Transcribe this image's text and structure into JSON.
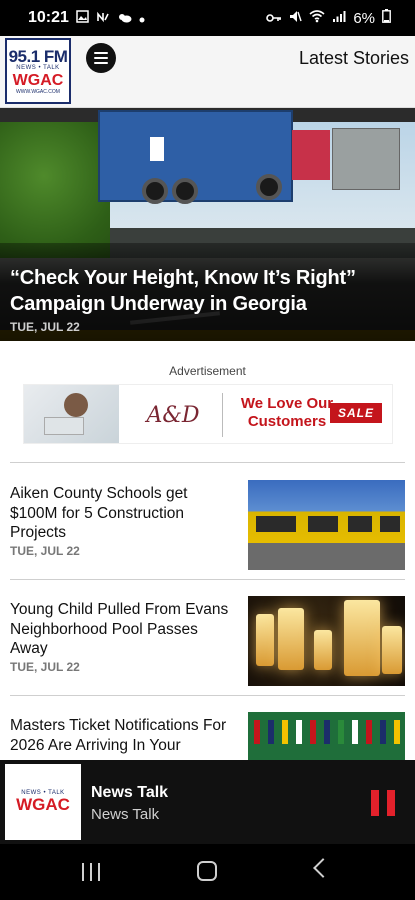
{
  "status_bar": {
    "time": "10:21",
    "battery": "6%",
    "left_icons": [
      "gallery-icon",
      "nfc-icon",
      "weather-icon",
      "dot-icon"
    ],
    "right_icons": [
      "key-icon",
      "mute-icon",
      "wifi-icon",
      "signal-icon",
      "battery-icon"
    ]
  },
  "header": {
    "logo": {
      "frequency": "95.1 FM",
      "tagline": "NEWS • TALK",
      "call_sign": "WGAC",
      "url": "WWW.WGAC.COM"
    },
    "menu_icon": "menu-icon",
    "title": "Latest Stories"
  },
  "hero": {
    "headline": "“Check Your Height, Know It’s Right” Campaign Underway in Georgia",
    "date": "TUE, JUL 22"
  },
  "ad": {
    "label": "Advertisement",
    "brand_monogram": "A&D",
    "tagline": "We Love Our Customers",
    "badge": "SALE"
  },
  "stories": [
    {
      "headline": "Aiken County Schools get $100M for 5 Construction Projects",
      "date": "TUE, JUL 22",
      "thumb": "school-buses"
    },
    {
      "headline": "Young Child Pulled From Evans Neighborhood Pool Passes Away",
      "date": "TUE, JUL 22",
      "thumb": "candles"
    },
    {
      "headline": "Masters Ticket Notifications For 2026 Are Arriving In Your",
      "date": "",
      "thumb": "masters"
    }
  ],
  "player": {
    "logo": {
      "tagline": "NEWS • TALK",
      "call_sign": "WGAC"
    },
    "title": "News Talk",
    "subtitle": "News Talk",
    "state": "playing"
  },
  "nav": {
    "icons": [
      "recent-apps-icon",
      "home-icon",
      "back-icon"
    ]
  }
}
